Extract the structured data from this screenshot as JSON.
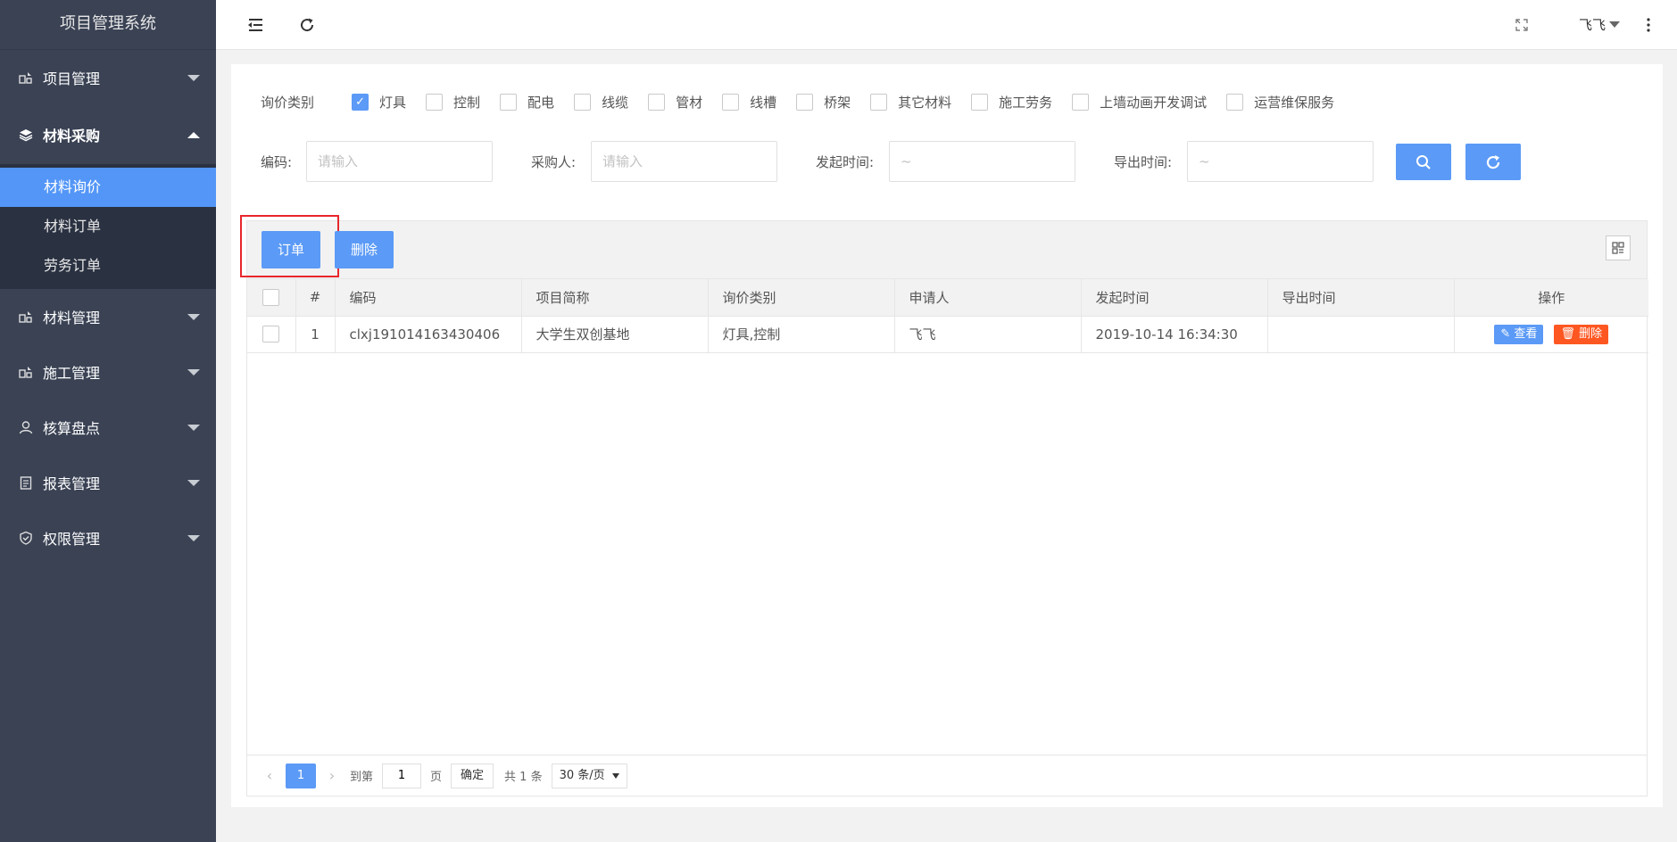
{
  "sidebar": {
    "logo": "项目管理系统",
    "items": [
      {
        "label": "项目管理",
        "icon": "project-icon"
      },
      {
        "label": "材料采购",
        "icon": "layers-icon"
      },
      {
        "label": "材料管理",
        "icon": "project-icon"
      },
      {
        "label": "施工管理",
        "icon": "project-icon"
      },
      {
        "label": "核算盘点",
        "icon": "user-icon"
      },
      {
        "label": "报表管理",
        "icon": "report-icon"
      },
      {
        "label": "权限管理",
        "icon": "shield-icon"
      }
    ],
    "subitems": [
      "材料询价",
      "材料订单",
      "劳务订单"
    ]
  },
  "header": {
    "user": "飞飞"
  },
  "filter": {
    "label": "询价类别",
    "options": [
      {
        "label": "灯具",
        "checked": true
      },
      {
        "label": "控制",
        "checked": false
      },
      {
        "label": "配电",
        "checked": false
      },
      {
        "label": "线缆",
        "checked": false
      },
      {
        "label": "管材",
        "checked": false
      },
      {
        "label": "线槽",
        "checked": false
      },
      {
        "label": "桥架",
        "checked": false
      },
      {
        "label": "其它材料",
        "checked": false
      },
      {
        "label": "施工劳务",
        "checked": false
      },
      {
        "label": "上墙动画开发调试",
        "checked": false
      },
      {
        "label": "运营维保服务",
        "checked": false
      }
    ]
  },
  "search": {
    "code_label": "编码:",
    "code_placeholder": "请输入",
    "buyer_label": "采购人:",
    "buyer_placeholder": "请输入",
    "start_label": "发起时间:",
    "start_placeholder": "~",
    "export_label": "导出时间:",
    "export_placeholder": "~"
  },
  "toolbar": {
    "order_label": "订单",
    "delete_label": "删除"
  },
  "table": {
    "headers": [
      "#",
      "编码",
      "项目简称",
      "询价类别",
      "申请人",
      "发起时间",
      "导出时间",
      "操作"
    ],
    "rows": [
      {
        "index": "1",
        "code": "clxj191014163430406",
        "project": "大学生双创基地",
        "category": "灯具,控制",
        "applicant": "飞飞",
        "start_time": "2019-10-14 16:34:30",
        "export_time": "",
        "view_label": "查看",
        "delete_label": "删除"
      }
    ]
  },
  "pager": {
    "current": "1",
    "goto_label": "到第",
    "goto_value": "1",
    "page_label": "页",
    "ok_label": "确定",
    "total": "共 1 条",
    "page_size": "30 条/页"
  }
}
